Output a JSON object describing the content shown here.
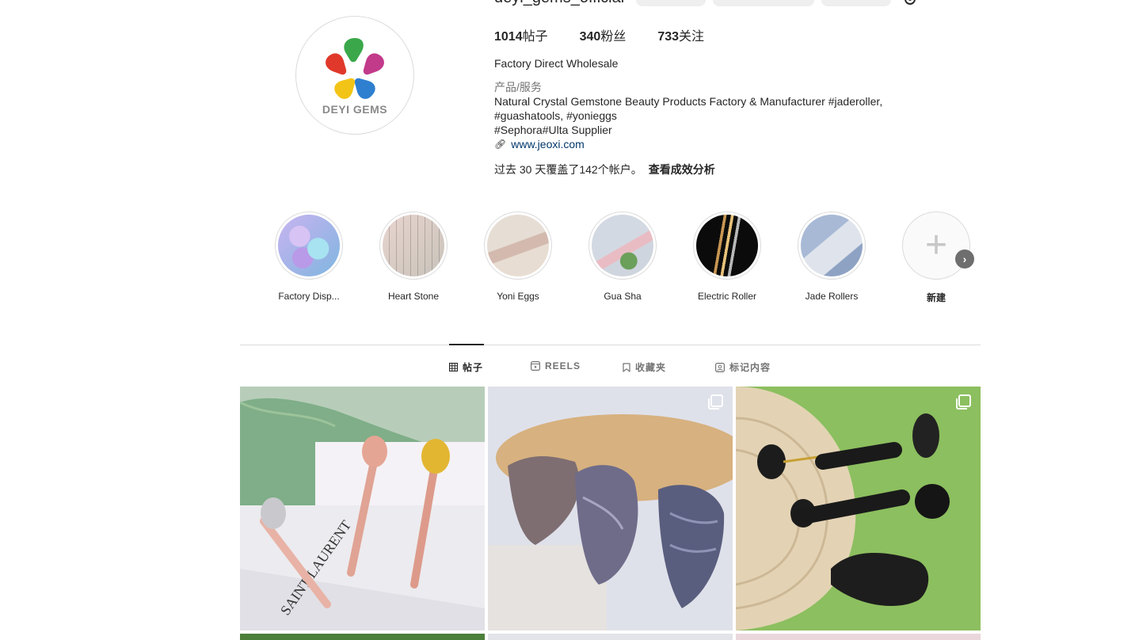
{
  "profile": {
    "username": "deyi_gems_official",
    "avatar_text": "DEYI GEMS",
    "stats": {
      "posts_count": "1014",
      "posts_label": "帖子",
      "followers_count": "340",
      "followers_label": "粉丝",
      "following_count": "733",
      "following_label": "关注"
    },
    "bio": {
      "name": "Factory Direct Wholesale",
      "category": "产品/服务",
      "line1": "Natural Crystal Gemstone Beauty Products Factory & Manufacturer #jaderoller,",
      "line2": "#guashatools, #yonieggs",
      "line3": "#Sephora#Ulta Supplier",
      "link_icon": "link-icon",
      "website": "www.jeoxi.com"
    },
    "reach": {
      "text": "过去 30 天覆盖了142个帐户。",
      "insights_link": "查看成效分析"
    }
  },
  "highlights": [
    {
      "label": "Factory Disp...",
      "colors": [
        "#b9a3e8",
        "#7fc7d9"
      ]
    },
    {
      "label": "Heart Stone",
      "colors": [
        "#e8d2cc",
        "#c7c2b9"
      ]
    },
    {
      "label": "Yoni Eggs",
      "colors": [
        "#d9c9bd",
        "#e8ddd2"
      ]
    },
    {
      "label": "Gua Sha",
      "colors": [
        "#cdd3dc",
        "#e8b7bf"
      ]
    },
    {
      "label": "Electric Roller",
      "colors": [
        "#0d0d0d",
        "#c9a062"
      ]
    },
    {
      "label": "Jade Rollers",
      "colors": [
        "#9fb2cf",
        "#d9dee8"
      ]
    },
    {
      "label": "新建",
      "icon": "plus-icon"
    }
  ],
  "tabs": [
    {
      "label": "帖子",
      "icon": "grid-icon",
      "active": true
    },
    {
      "label": "REELS",
      "icon": "reels-icon",
      "active": false
    },
    {
      "label": "收藏夹",
      "icon": "bookmark-icon",
      "active": false
    },
    {
      "label": "标记内容",
      "icon": "tagged-icon",
      "active": false
    }
  ],
  "posts": [
    {
      "description": "rose gold roller wands",
      "multi": false
    },
    {
      "description": "agate gua sha stones",
      "multi": true
    },
    {
      "description": "black obsidian rollers",
      "multi": true
    }
  ],
  "colors": {
    "text": "#262626",
    "muted": "#737373",
    "link": "#00376b",
    "border": "#dbdbdb"
  }
}
